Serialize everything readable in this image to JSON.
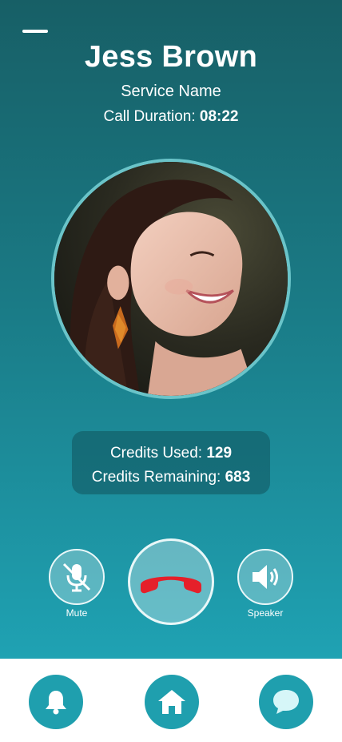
{
  "caller": {
    "name": "Jess Brown",
    "service": "Service Name",
    "duration_label": "Call Duration:",
    "duration_value": "08:22"
  },
  "credits": {
    "used_label": "Credits Used:",
    "used_value": "129",
    "remaining_label": "Credits Remaining:",
    "remaining_value": "683"
  },
  "controls": {
    "mute_label": "Mute",
    "speaker_label": "Speaker",
    "mute_icon": "mic-off-icon",
    "end_icon": "phone-hangup-icon",
    "speaker_icon": "speaker-icon"
  },
  "nav": {
    "items": [
      {
        "icon": "bell-icon"
      },
      {
        "icon": "home-icon"
      },
      {
        "icon": "chat-icon"
      }
    ]
  },
  "colors": {
    "gradient_top": "#175f66",
    "gradient_bottom": "#1fa2b3",
    "end_call_red": "#e5202a",
    "nav_accent": "#1f9fae"
  }
}
